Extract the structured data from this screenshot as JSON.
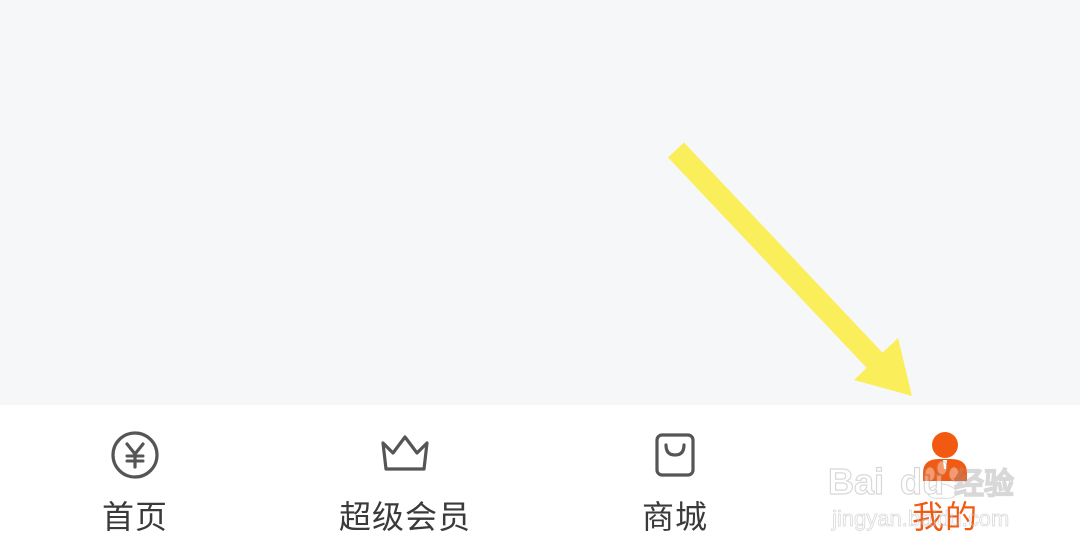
{
  "theme": {
    "accent": "#f25a12",
    "inactive_text": "#3a3a3a",
    "inactive_icon": "#555555",
    "annotation_arrow": "#fbee5b"
  },
  "tab_bar": {
    "tabs": [
      {
        "key": "home",
        "label": "首页",
        "icon": "yuan-circle-icon",
        "active": false
      },
      {
        "key": "vip",
        "label": "超级会员",
        "icon": "crown-icon",
        "active": false
      },
      {
        "key": "mall",
        "label": "商城",
        "icon": "shopping-bag-icon",
        "active": false
      },
      {
        "key": "mine",
        "label": "我的",
        "icon": "user-icon",
        "active": true
      }
    ]
  },
  "annotation": {
    "icon": "arrow-pointer-icon"
  },
  "watermark": {
    "text": "Baidu经验",
    "subtext": "jingyan.baidu.com"
  }
}
